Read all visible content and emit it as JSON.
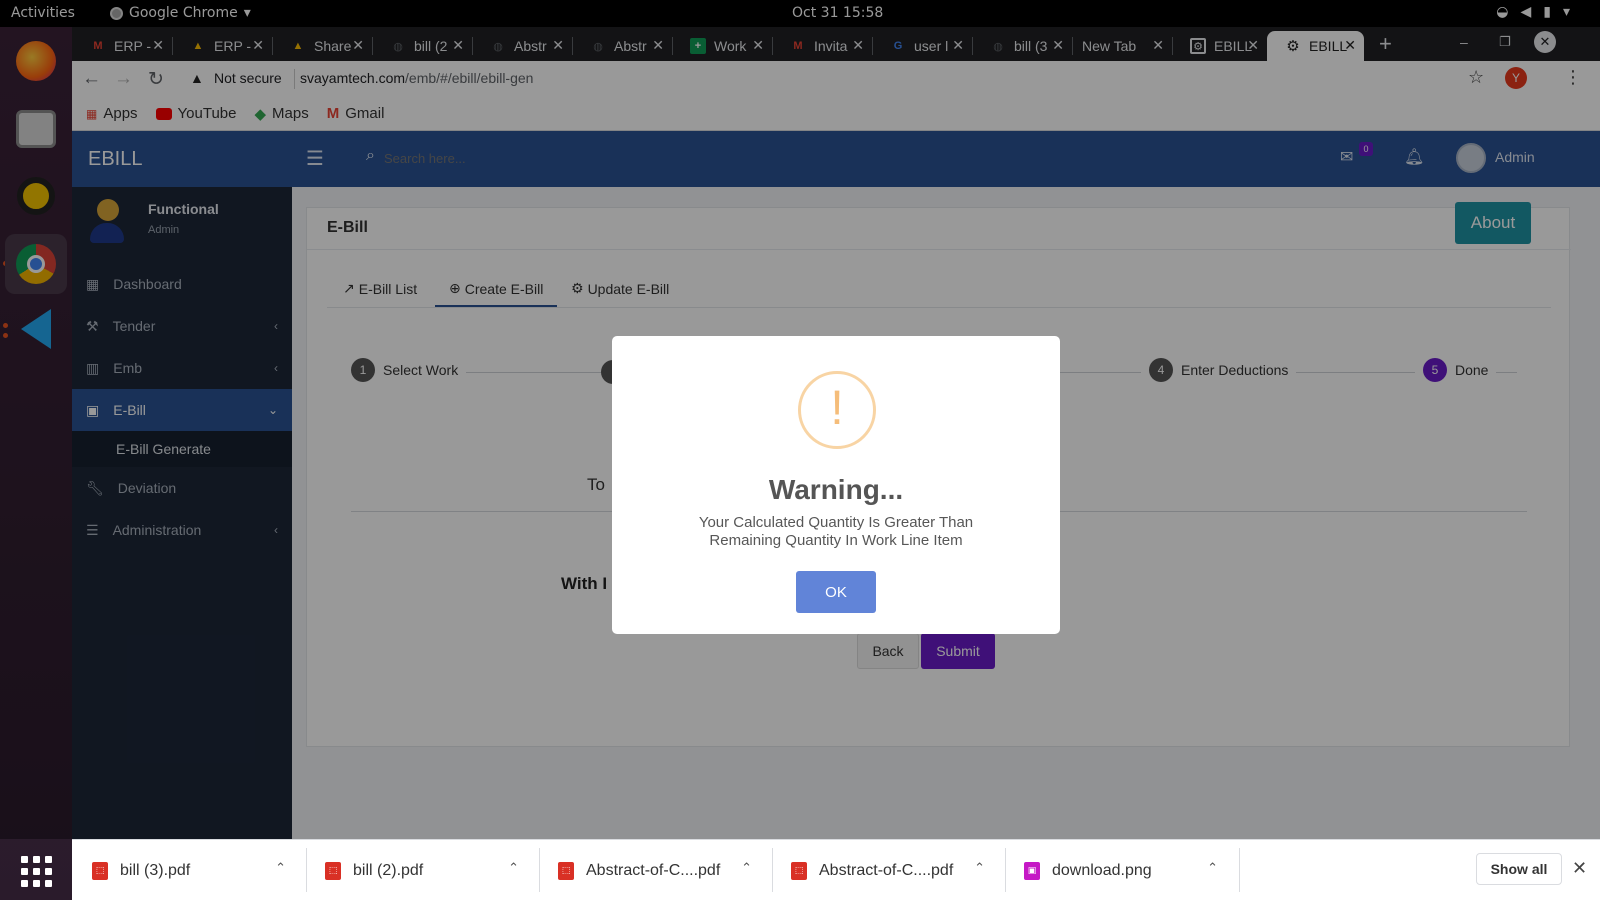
{
  "os": {
    "activities": "Activities",
    "app_name": "Google Chrome",
    "clock": "Oct 31  15:58"
  },
  "tabs": [
    {
      "label": "ERP -",
      "icon": "gmail-icon"
    },
    {
      "label": "ERP -",
      "icon": "drive-icon"
    },
    {
      "label": "Share",
      "icon": "drive-icon"
    },
    {
      "label": "bill (2",
      "icon": "globe-icon"
    },
    {
      "label": "Abstr",
      "icon": "globe-icon"
    },
    {
      "label": "Abstr",
      "icon": "globe-icon"
    },
    {
      "label": "Work",
      "icon": "sheets-icon"
    },
    {
      "label": "Invita",
      "icon": "gmail-icon"
    },
    {
      "label": "user l",
      "icon": "google-icon"
    },
    {
      "label": "bill (3",
      "icon": "globe-icon"
    },
    {
      "label": "New Tab",
      "icon": ""
    },
    {
      "label": "EBILL",
      "icon": "ebill-icon"
    },
    {
      "label": "EBILL",
      "icon": "gear-icon",
      "active": true
    }
  ],
  "address": {
    "security": "Not secure",
    "domain": "svayamtech.com",
    "path": "/emb/#/ebill/ebill-gen",
    "profile_initial": "Y"
  },
  "bookmarks": [
    "Apps",
    "YouTube",
    "Maps",
    "Gmail"
  ],
  "app": {
    "brand": "EBILL",
    "search_placeholder": "Search here...",
    "mail_badge": "0",
    "user": "Admin",
    "profile_name": "Functional",
    "profile_role": "Admin",
    "sidebar": [
      {
        "label": "Dashboard"
      },
      {
        "label": "Tender"
      },
      {
        "label": "Emb"
      },
      {
        "label": "E-Bill"
      },
      {
        "label": "E-Bill Generate"
      },
      {
        "label": "Deviation"
      },
      {
        "label": "Administration"
      }
    ],
    "page_title": "E-Bill",
    "about_label": "About",
    "content_tabs": [
      "E-Bill List",
      "Create E-Bill",
      "Update E-Bill"
    ],
    "steps": [
      {
        "num": "1",
        "label": "Select Work"
      },
      {
        "num": "4",
        "label": "Enter Deductions"
      },
      {
        "num": "5",
        "label": "Done"
      }
    ],
    "partial_text_1": "To",
    "partial_text_2": "With I",
    "back_label": "Back",
    "submit_label": "Submit"
  },
  "modal": {
    "icon": "!",
    "title": "Warning...",
    "message_line1": "Your Calculated Quantity Is Greater Than",
    "message_line2": "Remaining Quantity In Work Line Item",
    "ok_label": "OK"
  },
  "downloads": {
    "items": [
      "bill (3).pdf",
      "bill (2).pdf",
      "Abstract-of-C....pdf",
      "Abstract-of-C....pdf",
      "download.png"
    ],
    "show_all": "Show all"
  }
}
